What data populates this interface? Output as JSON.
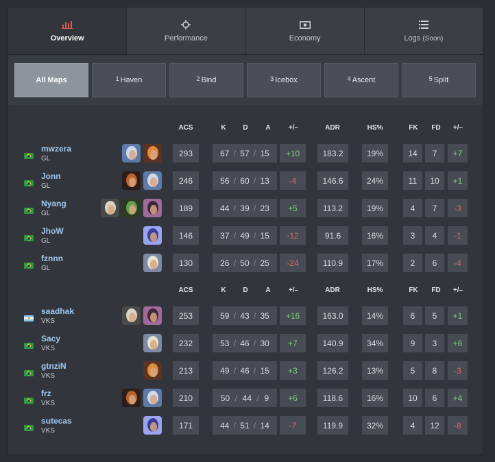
{
  "tabs": [
    {
      "label": "Overview",
      "icon": "bar-chart-icon"
    },
    {
      "label": "Performance",
      "icon": "crosshair-icon"
    },
    {
      "label": "Economy",
      "icon": "banknote-icon"
    },
    {
      "label": "Logs",
      "soon": "(Soon)",
      "icon": "list-icon"
    }
  ],
  "maps": [
    {
      "num": "",
      "label": "All Maps"
    },
    {
      "num": "1",
      "label": "Haven"
    },
    {
      "num": "2",
      "label": "Bind"
    },
    {
      "num": "3",
      "label": "Icebox"
    },
    {
      "num": "4",
      "label": "Ascent"
    },
    {
      "num": "5",
      "label": "Split"
    }
  ],
  "headers": {
    "acs": "ACS",
    "k": "K",
    "d": "D",
    "a": "A",
    "pm": "+/–",
    "adr": "ADR",
    "hs": "HS%",
    "fk": "FK",
    "fd": "FD",
    "fpm": "+/–"
  },
  "teams": [
    {
      "players": [
        {
          "name": "mwzera",
          "team": "GL",
          "flag": "br",
          "agents": [
            "jett",
            "raze"
          ],
          "acs": "293",
          "k": "67",
          "d": "57",
          "a": "15",
          "pm": "+10",
          "adr": "183.2",
          "hs": "19%",
          "fk": "14",
          "fd": "7",
          "fpm": "+7"
        },
        {
          "name": "Jonn",
          "team": "GL",
          "flag": "br",
          "agents": [
            "phoenix",
            "jett"
          ],
          "acs": "246",
          "k": "56",
          "d": "60",
          "a": "13",
          "pm": "-4",
          "adr": "146.6",
          "hs": "24%",
          "fk": "11",
          "fd": "10",
          "fpm": "+1"
        },
        {
          "name": "Nyang",
          "team": "GL",
          "flag": "br",
          "agents": [
            "cypher",
            "skye",
            "reyna"
          ],
          "acs": "189",
          "k": "44",
          "d": "39",
          "a": "23",
          "pm": "+5",
          "adr": "113.2",
          "hs": "19%",
          "fk": "4",
          "fd": "7",
          "fpm": "-3"
        },
        {
          "name": "JhoW",
          "team": "GL",
          "flag": "br",
          "agents": [
            "omen"
          ],
          "acs": "146",
          "k": "37",
          "d": "49",
          "a": "15",
          "pm": "-12",
          "adr": "91.6",
          "hs": "16%",
          "fk": "3",
          "fd": "4",
          "fpm": "-1"
        },
        {
          "name": "fznnn",
          "team": "GL",
          "flag": "br",
          "agents": [
            "sova"
          ],
          "acs": "130",
          "k": "26",
          "d": "50",
          "a": "25",
          "pm": "-24",
          "adr": "110.9",
          "hs": "17%",
          "fk": "2",
          "fd": "6",
          "fpm": "-4"
        }
      ]
    },
    {
      "players": [
        {
          "name": "saadhak",
          "team": "VKS",
          "flag": "ar",
          "agents": [
            "cypher",
            "reyna"
          ],
          "acs": "253",
          "k": "59",
          "d": "43",
          "a": "35",
          "pm": "+16",
          "adr": "163.0",
          "hs": "14%",
          "fk": "6",
          "fd": "5",
          "fpm": "+1"
        },
        {
          "name": "Sacy",
          "team": "VKS",
          "flag": "br",
          "agents": [
            "sova"
          ],
          "acs": "232",
          "k": "53",
          "d": "46",
          "a": "30",
          "pm": "+7",
          "adr": "140.9",
          "hs": "34%",
          "fk": "9",
          "fd": "3",
          "fpm": "+6"
        },
        {
          "name": "gtnziN",
          "team": "VKS",
          "flag": "br",
          "agents": [
            "raze"
          ],
          "acs": "213",
          "k": "49",
          "d": "46",
          "a": "15",
          "pm": "+3",
          "adr": "126.2",
          "hs": "13%",
          "fk": "5",
          "fd": "8",
          "fpm": "-3"
        },
        {
          "name": "frz",
          "team": "VKS",
          "flag": "br",
          "agents": [
            "phoenix",
            "jett"
          ],
          "acs": "210",
          "k": "50",
          "d": "44",
          "a": "9",
          "pm": "+6",
          "adr": "118.6",
          "hs": "16%",
          "fk": "10",
          "fd": "6",
          "fpm": "+4"
        },
        {
          "name": "sutecas",
          "team": "VKS",
          "flag": "br",
          "agents": [
            "omen"
          ],
          "acs": "171",
          "k": "44",
          "d": "51",
          "a": "14",
          "pm": "-7",
          "adr": "119.9",
          "hs": "32%",
          "fk": "4",
          "fd": "12",
          "fpm": "-8"
        }
      ]
    }
  ],
  "colors": {
    "positive": "#7ecb7e",
    "negative": "#e0636a",
    "link": "#9fc7f0",
    "accent": "#e05a5a"
  }
}
